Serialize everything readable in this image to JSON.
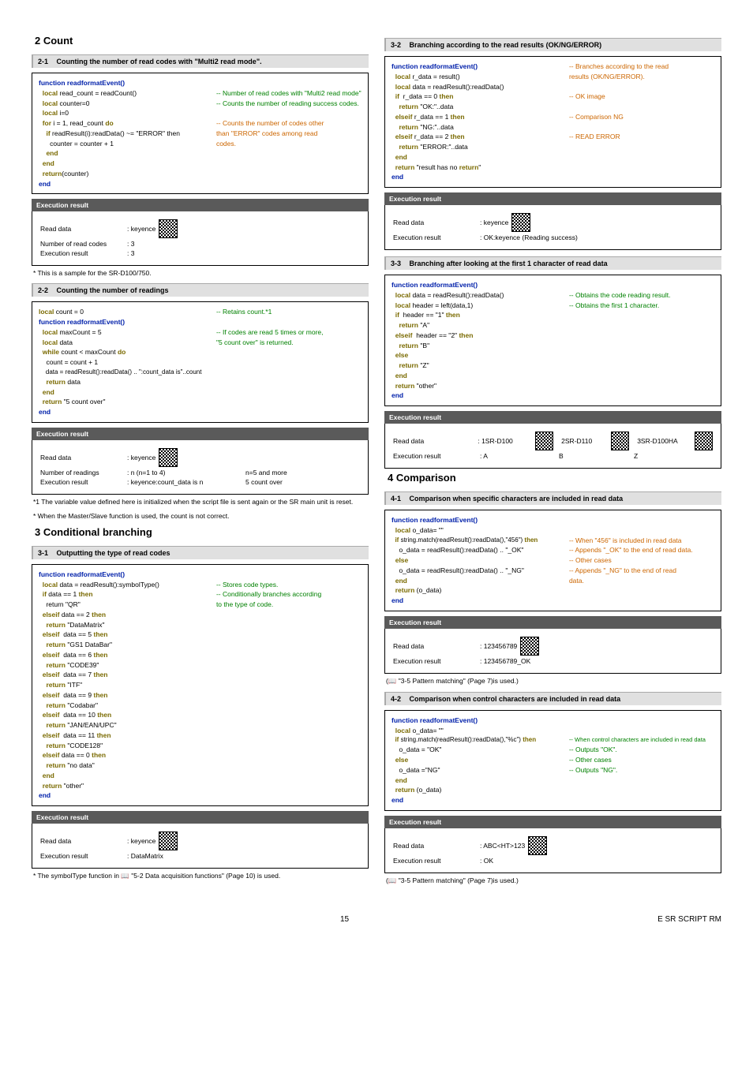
{
  "s2": {
    "title": "2  Count"
  },
  "s2_1": {
    "head_num": "2-1",
    "head_title": "Counting the number of read codes with \"Multi2 read mode\".",
    "c": {
      "l1": "function readformatEvent()",
      "l2a": "  local read_count = readCount()",
      "l2b": "-- Number of read codes with \"Multi2 read mode\"",
      "l3a": "  local counter=0",
      "l3b": "-- Counts the number of reading success codes.",
      "l4": "  local i=0",
      "l5a": "  for i = 1, read_count do",
      "l5b": "-- Counts the number of codes other",
      "l6a": "    if readResult(i):readData() ~= \"ERROR\" then",
      "l6b": "than \"ERROR\" codes among read",
      "l7a": "      counter = counter + 1",
      "l7b": "codes.",
      "l8": "    end",
      "l9": "  end",
      "l10": "  return(counter)",
      "l11": "end"
    },
    "exec": {
      "title": "Execution result",
      "r1l": "Read data",
      "r1v": ": keyence",
      "r2l": "Number of read codes",
      "r2v": ": 3",
      "r3l": "Execution result",
      "r3v": ": 3"
    },
    "note": "* This is a sample for the SR-D100/750."
  },
  "s2_2": {
    "head_num": "2-2",
    "head_title": "Counting the number of readings",
    "c": {
      "l1a": "local count = 0",
      "l1b": "-- Retains count.*1",
      "l2": "function readformatEvent()",
      "l3a": "  local maxCount = 5",
      "l3b": "-- If codes are read 5 times or more,",
      "l4a": "  local data",
      "l4b": "\"5 count over\" is returned.",
      "l5": "  while count < maxCount do",
      "l6": "    count = count + 1",
      "l7": "    data = readResult():readData() .. \":count_data is\"..count",
      "l8": "    return data",
      "l9": "  end",
      "l10": "  return \"5 count over\"",
      "l11": "end"
    },
    "exec": {
      "title": "Execution result",
      "r1l": "Read data",
      "r1v": ": keyence",
      "r2l": "Number of readings",
      "r2v": ": n (n=1 to 4)",
      "r2r": "n=5 and more",
      "r3l": "Execution result",
      "r3v": ": keyence:count_data is n",
      "r3r": "5 count over"
    },
    "note1": "*1  The variable value defined here is initialized when the script file is sent again or the SR main unit is reset.",
    "note2": "*  When the Master/Slave function is used, the count is not correct."
  },
  "s3": {
    "title": "3  Conditional branching"
  },
  "s3_1": {
    "head_num": "3-1",
    "head_title": "Outputting the type of read codes",
    "c": {
      "l1": "function readformatEvent()",
      "l2a": "  local data = readResult():symbolType()",
      "l2b": "-- Stores code types.",
      "l3a": "  if data == 1 then",
      "l3b": "-- Conditionally branches according",
      "l4a": "    return \"QR\"",
      "l4b": "to the type of code.",
      "l5": "  elseif data == 2 then",
      "l6": "    return \"DataMatrix\"",
      "l7": "  elseif  data == 5 then",
      "l8": "    return \"GS1 DataBar\"",
      "l9": "  elseif  data == 6 then",
      "l10": "    return \"CODE39\"",
      "l11": "  elseif  data == 7 then",
      "l12": "    return \"ITF\"",
      "l13": "  elseif  data == 9 then",
      "l14": "    return \"Codabar\"",
      "l15": "  elseif  data == 10 then",
      "l16": "    return \"JAN/EAN/UPC\"",
      "l17": "  elseif  data == 11 then",
      "l18": "    return \"CODE128\"",
      "l19": "  elseif data == 0 then",
      "l20": "    return \"no data\"",
      "l21": "  end",
      "l22": "  return \"other\"",
      "l23": "end"
    },
    "exec": {
      "title": "Execution result",
      "r1l": "Read data",
      "r1v": ": keyence",
      "r2l": "Execution result",
      "r2v": ": DataMatrix"
    },
    "note": "*  The symbolType function in 📖 \"5-2 Data acquisition functions\" (Page 10) is used."
  },
  "s3_2": {
    "head_num": "3-2",
    "head_title": "Branching according to the read results (OK/NG/ERROR)",
    "c": {
      "l1a": "function readformatEvent()",
      "l1b": "-- Branches according to the read",
      "l2a": "  local r_data = result()",
      "l2b": "results (OK/NG/ERROR).",
      "l3": "  local data = readResult():readData()",
      "l4a": "  if  r_data == 0 then",
      "l4b": "-- OK image",
      "l5": "    return \"OK:\"..data",
      "l6a": "  elseif r_data == 1 then",
      "l6b": "-- Comparison NG",
      "l7": "    return \"NG:\"..data",
      "l8a": "  elseif r_data == 2 then",
      "l8b": "-- READ ERROR",
      "l9": "    return \"ERROR:\"..data",
      "l10": "  end",
      "l11": "  return \"result has no return\"",
      "l12": "end"
    },
    "exec": {
      "title": "Execution result",
      "r1l": "Read data",
      "r1v": ": keyence",
      "r2l": "Execution result",
      "r2v": ": OK:keyence       (Reading success)"
    }
  },
  "s3_3": {
    "head_num": "3-3",
    "head_title": "Branching after looking at the first 1 character of read data",
    "c": {
      "l1": "function readformatEvent()",
      "l2a": "  local data = readResult():readData()",
      "l2b": "-- Obtains the code reading result.",
      "l3a": "  local header = left(data,1)",
      "l3b": "-- Obtains the first 1 character.",
      "l4": "  if  header == \"1\" then",
      "l5": "    return \"A\"",
      "l6": "  elseif  header == \"2\" then",
      "l7": "    return \"B\"",
      "l8": "  else",
      "l9": "    return \"Z\"",
      "l10": "  end",
      "l11": "  return \"other\"",
      "l12": "end"
    },
    "exec": {
      "title": "Execution result",
      "r1l": "Read data",
      "r1v1": ": 1SR-D100",
      "r1v2": "2SR-D110",
      "r1v3": "3SR-D100HA",
      "r2l": "Execution result",
      "r2v1": ": A",
      "r2v2": "B",
      "r2v3": "Z"
    }
  },
  "s4": {
    "title": "4  Comparison"
  },
  "s4_1": {
    "head_num": "4-1",
    "head_title": "Comparison when specific characters are included in read data",
    "c": {
      "l1": "function readformatEvent()",
      "l2": "  local o_data= \"\"",
      "l3a": "  if string.match(readResult():readData(),\"456\") then",
      "l3b": "-- When \"456\" is included in read data",
      "l4a": "    o_data = readResult():readData() .. \"_OK\"",
      "l4b": "-- Appends \"_OK\" to the end of read data.",
      "l5a": "  else",
      "l5b": "-- Other cases",
      "l6a": "    o_data = readResult():readData() .. \"_NG\"",
      "l6b": "-- Appends \"_NG\" to the end of read",
      "l7a": "  end",
      "l7b": "data.",
      "l8": "  return (o_data)",
      "l9": "end"
    },
    "exec": {
      "title": "Execution result",
      "r1l": "Read data",
      "r1v": ": 123456789",
      "r2l": "Execution result",
      "r2v": ": 123456789_OK"
    },
    "note": "(📖 \"3-5 Pattern matching\" (Page 7)is used.)"
  },
  "s4_2": {
    "head_num": "4-2",
    "head_title": "Comparison when control characters are included in read data",
    "c": {
      "l1": "function readformatEvent()",
      "l2": "  local o_data= \"\"",
      "l3a": "  if string.match(readResult():readData(),\"%c\") then",
      "l3b": "-- When control characters are included in read data",
      "l4a": "    o_data = \"OK\"",
      "l4b": "-- Outputs \"OK\".",
      "l5a": "  else",
      "l5b": "-- Other cases",
      "l6a": "    o_data =\"NG\"",
      "l6b": "-- Outputs \"NG\".",
      "l7": "  end",
      "l8": "  return (o_data)",
      "l9": "end"
    },
    "exec": {
      "title": "Execution result",
      "r1l": "Read data",
      "r1v": ": ABC<HT>123",
      "r2l": "Execution result",
      "r2v": ": OK"
    },
    "note": "(📖 \"3-5 Pattern matching\" (Page 7)is used.)"
  },
  "footer": {
    "page": "15",
    "doc": "E SR SCRIPT RM"
  }
}
